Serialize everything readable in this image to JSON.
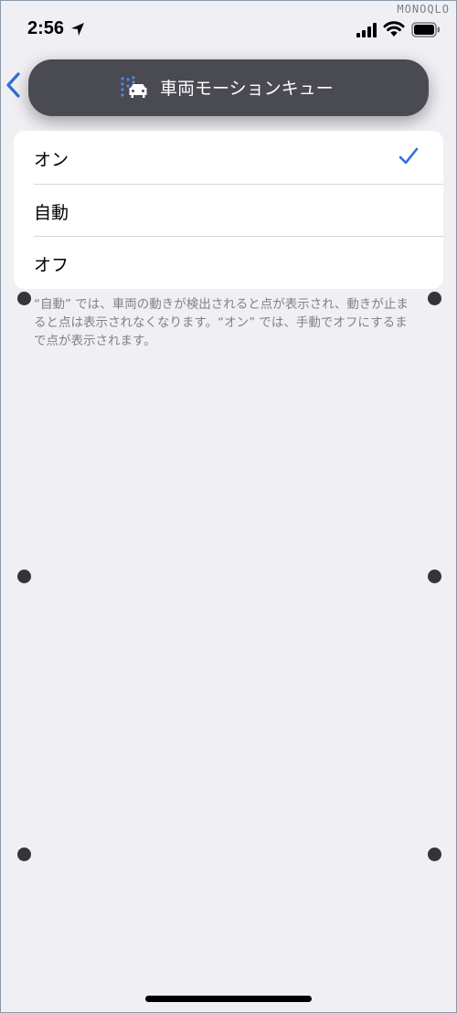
{
  "status_bar": {
    "time": "2:56",
    "icons": [
      "location-arrow-icon",
      "cellular-signal-icon",
      "wifi-icon",
      "battery-icon"
    ]
  },
  "watermark": "MONOQLO",
  "banner": {
    "icon": "vehicle-motion-cues-icon",
    "title": "車両モーションキュー"
  },
  "nav": {
    "back_icon": "chevron-left-icon"
  },
  "options": [
    {
      "label": "オン",
      "selected": true
    },
    {
      "label": "自動",
      "selected": false
    },
    {
      "label": "オフ",
      "selected": false
    }
  ],
  "footer_note": "“自動” では、車両の動きが検出されると点が表示され、動きが止まると点は表示されなくなります。“オン” では、手動でオフにするまで点が表示されます。",
  "colors": {
    "accent": "#2f6fd0",
    "background": "#f0f0f4",
    "banner": "#4a4a52",
    "handle": "#333538"
  }
}
